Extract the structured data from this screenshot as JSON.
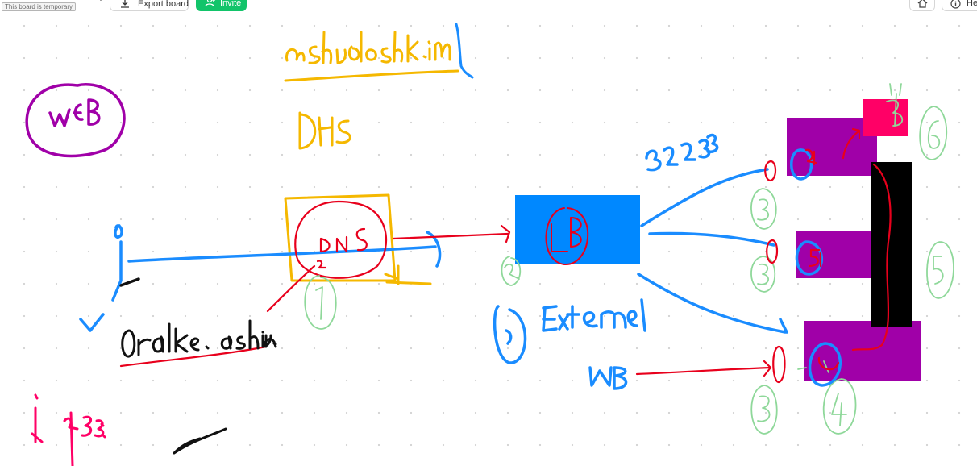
{
  "app": {
    "temporary_badge": "This board is temporary",
    "toolbar": {
      "export_label": "Export board",
      "invite_label": "Invite",
      "help_label": "He"
    }
  },
  "colors": {
    "blue_box": "#0088ff",
    "purple_box": "#a000a8",
    "black_box": "#000000",
    "pink_box": "#ff0066",
    "invite_green": "#12c46a"
  },
  "icons": {
    "export": "download-icon",
    "invite": "add-user-icon",
    "home": "home-icon",
    "help": "info-icon",
    "menu": "chevron-down-icon"
  }
}
